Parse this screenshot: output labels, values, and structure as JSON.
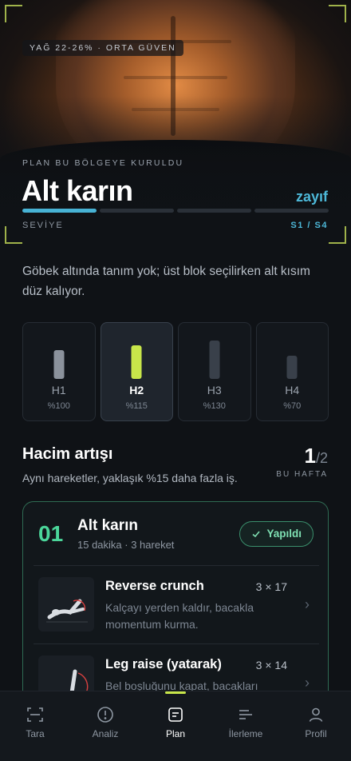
{
  "hero": {
    "fat_badge": "YAĞ 22-26% · ORTA GÜVEN",
    "eyebrow": "PLAN BU BÖLGEYE KURULDU",
    "title": "Alt karın",
    "status": "zayıf",
    "level_label": "SEVİYE",
    "level_value": "S1 / S4",
    "level_segments": [
      true,
      false,
      false,
      false
    ],
    "colors": {
      "accent": "#4db8d8",
      "frame": "#9fb24a"
    }
  },
  "description": "Göbek altında tanım yok; üst blok seçilirken alt kısım düz kalıyor.",
  "weeks": [
    {
      "name": "H1",
      "pct": "%100",
      "level": 0.62,
      "color": "#8b929c",
      "selected": false
    },
    {
      "name": "H2",
      "pct": "%115",
      "level": 0.72,
      "color": "#c8e64a",
      "selected": true
    },
    {
      "name": "H3",
      "pct": "%130",
      "level": 0.82,
      "color": "#39404a",
      "selected": false
    },
    {
      "name": "H4",
      "pct": "%70",
      "level": 0.5,
      "color": "#39404a",
      "selected": false
    }
  ],
  "volume": {
    "title": "Hacim artışı",
    "subtitle": "Aynı hareketler, yaklaşık %15 daha fazla iş.",
    "week_current": "1",
    "week_total": "/2",
    "week_label": "BU HAFTA"
  },
  "block": {
    "number": "01",
    "title": "Alt karın",
    "meta": "15 dakika · 3 hareket",
    "done_label": "Yapıldı",
    "accent": "#4bd69a",
    "exercises": [
      {
        "name": "Reverse crunch",
        "sets": "3 × 17",
        "desc": "Kalçayı yerden kaldır, bacakla momentum kurma."
      },
      {
        "name": "Leg raise (yatarak)",
        "sets": "3 × 14",
        "desc": "Bel boşluğunu kapat, bacakları"
      }
    ]
  },
  "nav": {
    "items": [
      {
        "label": "Tara",
        "icon": "scan-icon"
      },
      {
        "label": "Analiz",
        "icon": "alert-circle-icon"
      },
      {
        "label": "Plan",
        "icon": "plan-icon"
      },
      {
        "label": "İlerleme",
        "icon": "progress-icon"
      },
      {
        "label": "Profil",
        "icon": "user-icon"
      }
    ],
    "active": "Plan"
  }
}
